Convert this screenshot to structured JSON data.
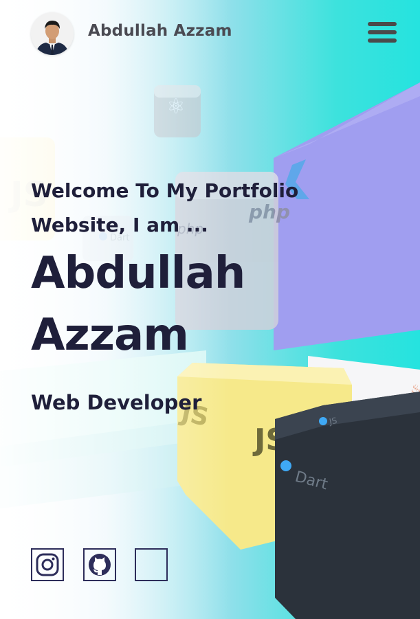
{
  "header": {
    "brand": "Abdullah Azzam",
    "menu_icon": "hamburger-menu-icon",
    "avatar_icon": "profile-photo"
  },
  "hero": {
    "welcome": "Welcome To My Portfolio Website, I am ...",
    "name": "Abdullah Azzam",
    "role": "Web Developer"
  },
  "background": {
    "cube_labels": [
      "JS",
      "JS",
      "php",
      "php",
      "Dart",
      "Dart",
      "JS",
      "⚛"
    ]
  },
  "socials": [
    {
      "icon": "instagram-icon"
    },
    {
      "icon": "github-icon"
    },
    {
      "icon": "blank-social-icon"
    }
  ],
  "colors": {
    "text": "#1f1f3a",
    "brand": "#4a4a52",
    "outline": "#2d2d5a",
    "teal": "#25e3df"
  }
}
